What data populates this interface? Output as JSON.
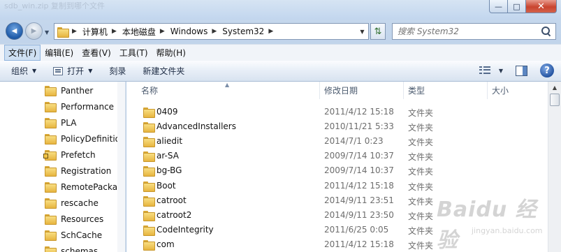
{
  "window": {
    "ghost_title": "sdb_win.zip 复制到哪个文件",
    "buttons": {
      "minimize": "—",
      "maximize": "□",
      "close": "✕"
    }
  },
  "nav": {
    "back_icon": "◀",
    "forward_icon": "▶",
    "breadcrumb": [
      "计算机",
      "本地磁盘",
      "Windows",
      "System32"
    ],
    "refresh_icon": "⇅",
    "search_placeholder": "搜索 System32"
  },
  "menubar": [
    "文件(F)",
    "编辑(E)",
    "查看(V)",
    "工具(T)",
    "帮助(H)"
  ],
  "commands": {
    "organize": "组织",
    "open": "打开",
    "burn": "刻录",
    "new_folder": "新建文件夹",
    "help": "?"
  },
  "tree": [
    "Panther",
    "Performance",
    "PLA",
    "PolicyDefinitions",
    "Prefetch",
    "Registration",
    "RemotePackages",
    "rescache",
    "Resources",
    "SchCache",
    "schemas"
  ],
  "columns": {
    "name": "名称",
    "date": "修改日期",
    "type": "类型",
    "size": "大小"
  },
  "files": [
    {
      "name": "0409",
      "date": "2011/4/12 15:18",
      "type": "文件夹"
    },
    {
      "name": "AdvancedInstallers",
      "date": "2010/11/21 5:33",
      "type": "文件夹"
    },
    {
      "name": "aliedit",
      "date": "2014/7/1 0:23",
      "type": "文件夹"
    },
    {
      "name": "ar-SA",
      "date": "2009/7/14 10:37",
      "type": "文件夹"
    },
    {
      "name": "bg-BG",
      "date": "2009/7/14 10:37",
      "type": "文件夹"
    },
    {
      "name": "Boot",
      "date": "2011/4/12 15:18",
      "type": "文件夹"
    },
    {
      "name": "catroot",
      "date": "2014/9/11 23:51",
      "type": "文件夹"
    },
    {
      "name": "catroot2",
      "date": "2014/9/11 23:50",
      "type": "文件夹"
    },
    {
      "name": "CodeIntegrity",
      "date": "2011/6/25 0:05",
      "type": "文件夹"
    },
    {
      "name": "com",
      "date": "2011/4/12 15:18",
      "type": "文件夹"
    }
  ],
  "watermark": {
    "main": "Baidu 经验",
    "sub": "jingyan.baidu.com"
  }
}
